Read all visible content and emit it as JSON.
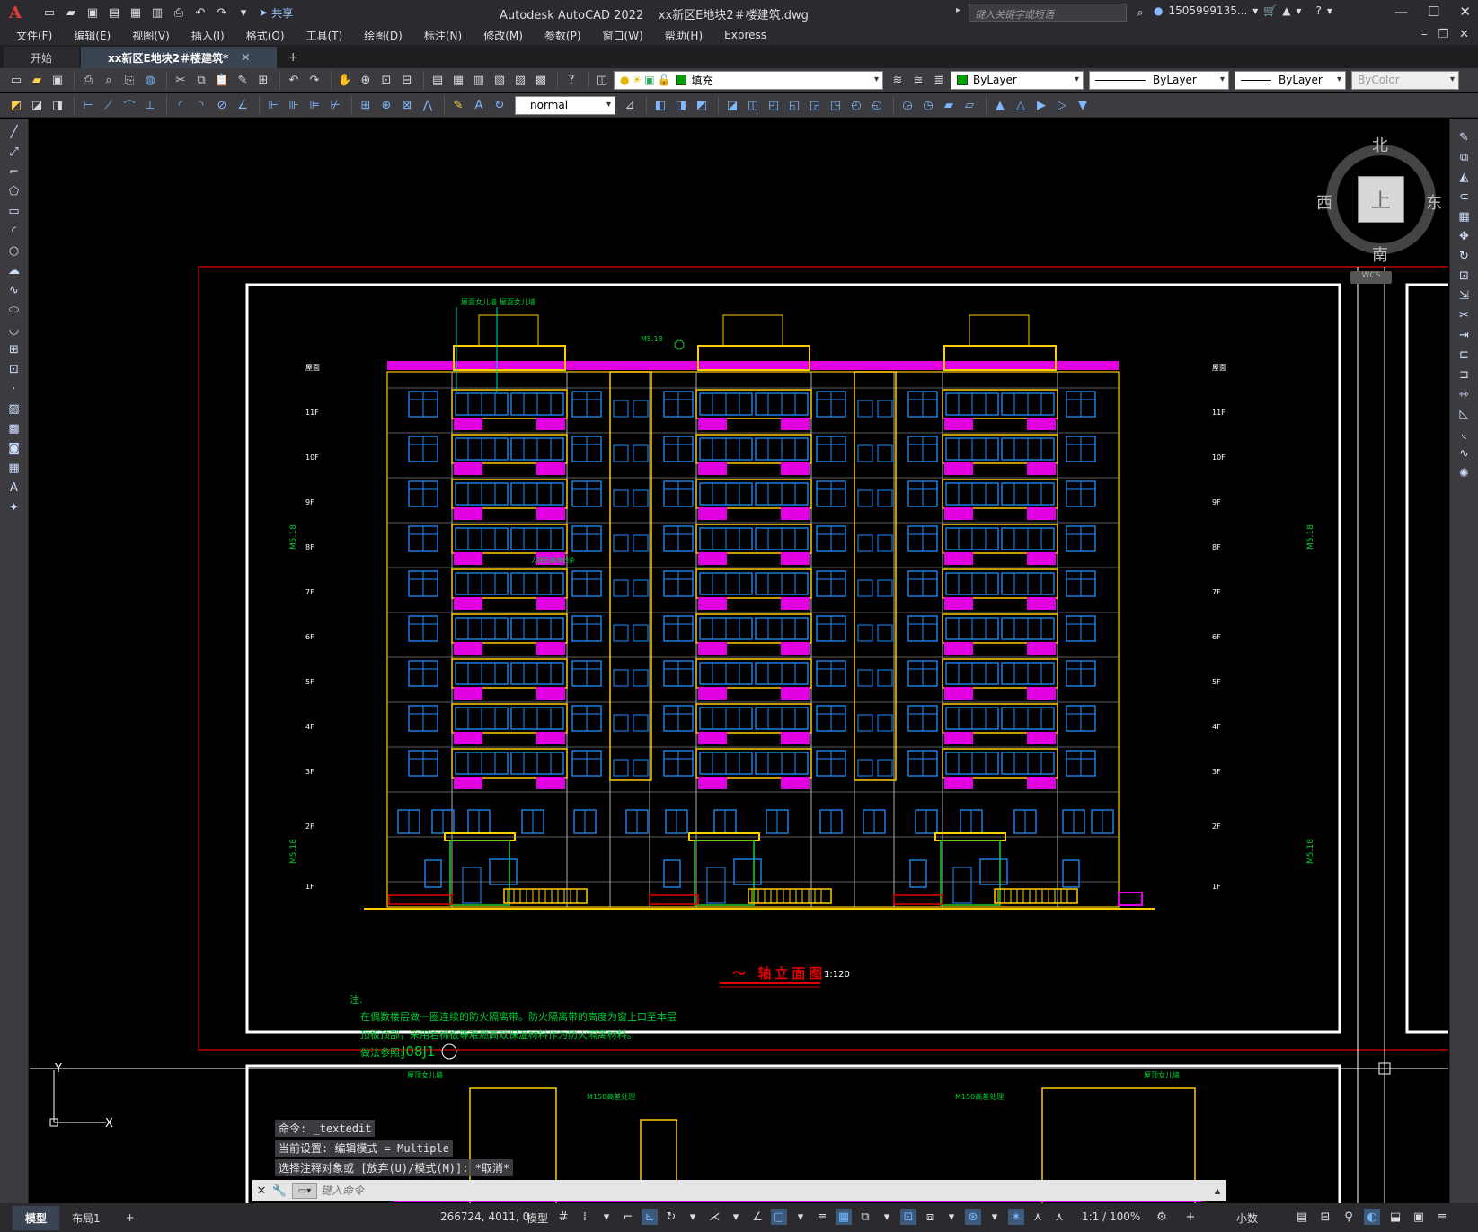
{
  "titlebar": {
    "app_title": "Autodesk AutoCAD 2022",
    "file_name": "xx新区E地块2＃楼建筑.dwg",
    "share_label": "共享",
    "search_placeholder": "键入关键字或短语",
    "user_name": "1505999135..."
  },
  "menu": {
    "items": [
      "文件(F)",
      "编辑(E)",
      "视图(V)",
      "插入(I)",
      "格式(O)",
      "工具(T)",
      "绘图(D)",
      "标注(N)",
      "修改(M)",
      "参数(P)",
      "窗口(W)",
      "帮助(H)",
      "Express"
    ]
  },
  "tabs": {
    "start": "开始",
    "active": "xx新区E地块2＃楼建筑*"
  },
  "toolbar1": {
    "layer_name": "填充",
    "color": "ByLayer",
    "linetype": "ByLayer",
    "lineweight": "ByLayer",
    "plotstyle": "ByColor"
  },
  "toolbar2": {
    "text_style": "normal"
  },
  "viewcube": {
    "north": "北",
    "south": "南",
    "east": "东",
    "west": "西",
    "top": "上",
    "wcs": "WCS"
  },
  "drawing": {
    "title": "～ 轴立面图",
    "scale": "1:120",
    "note_label": "注:",
    "note_line1": "在偶数楼层做一圈连续的防火隔离带。防火隔离带的高度为窗上口至本层",
    "note_line2": "顶板顶部，采用岩棉板等难燃高效保温材料作为防火隔离材料。",
    "note_line3": "做法参照:",
    "note_ref": "J08J1",
    "floors_left": [
      "屋面",
      "11F",
      "10F",
      "9F",
      "8F",
      "7F",
      "6F",
      "5F",
      "4F",
      "3F",
      "2F",
      "1F"
    ],
    "floors_right": [
      "屋面",
      "11F",
      "10F",
      "9F",
      "8F",
      "7F",
      "6F",
      "5F",
      "4F",
      "3F",
      "2F",
      "1F"
    ],
    "label_rooftop1": "屋面女儿墙",
    "label_rooftop2": "屋面女儿墙",
    "label_fire": "大理石装饰线条",
    "label_spec": "M5.18",
    "label_bottom1": "屋顶女儿墙",
    "label_bottom2": "M150高差处理"
  },
  "command": {
    "line1": "命令: _textedit",
    "line2": "当前设置: 编辑模式 = Multiple",
    "line3": "选择注释对象或 [放弃(U)/模式(M)]: *取消*",
    "input_placeholder": "键入命令"
  },
  "statusbar": {
    "tab_model": "模型",
    "tab_layout": "布局1",
    "coords": "266724, 4011, 0",
    "model": "模型",
    "zoom": "1:1 / 100%",
    "units": "小数"
  },
  "colors": {
    "wall": "#ffcc00",
    "window": "#1e90ff",
    "balcony": "#e000e0",
    "frame_red": "#c00000",
    "frame_white": "#ffffff",
    "note_green": "#00cc33"
  }
}
